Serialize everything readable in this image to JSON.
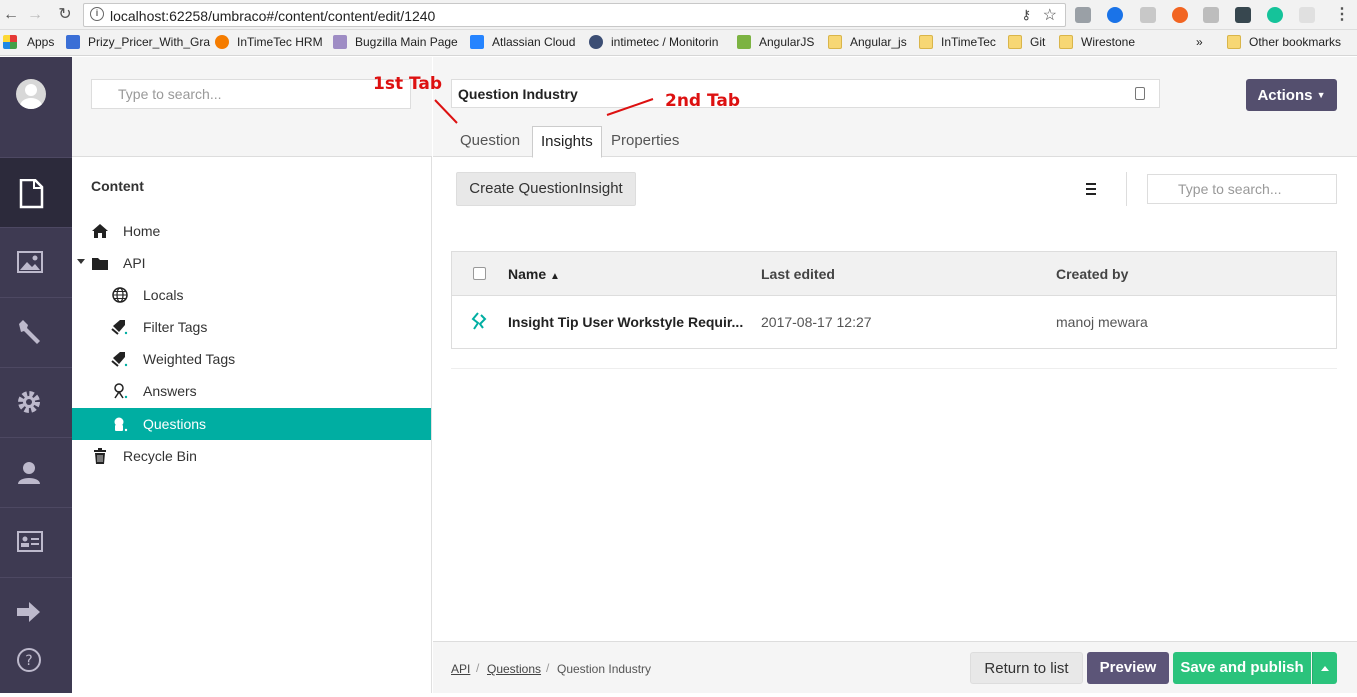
{
  "browser": {
    "url": "localhost:62258/umbraco#/content/content/edit/1240",
    "bookmarks": [
      {
        "label": "Apps",
        "color": "#e53935"
      },
      {
        "label": "Prizy_Pricer_With_Gra",
        "color": "#3b6fd6"
      },
      {
        "label": "InTimeTec HRM",
        "color": "#f57c00"
      },
      {
        "label": "Bugzilla Main Page",
        "color": "#9e8cc4"
      },
      {
        "label": "Atlassian Cloud",
        "color": "#2684ff"
      },
      {
        "label": "intimetec / Monitorin",
        "color": "#3c4e74"
      },
      {
        "label": "AngularJS",
        "color": "#7cb342"
      },
      {
        "label": "Angular_js",
        "color": "folder"
      },
      {
        "label": "InTimeTec",
        "color": "folder"
      },
      {
        "label": "Git",
        "color": "folder"
      },
      {
        "label": "Wirestone",
        "color": "folder"
      },
      {
        "label": "»",
        "color": "none"
      },
      {
        "label": "Other bookmarks",
        "color": "folder"
      }
    ]
  },
  "rail": {
    "items": [
      "content-icon",
      "media-icon",
      "developer-icon",
      "settings-icon",
      "users-icon",
      "members-icon",
      "forms-icon",
      "help-icon"
    ]
  },
  "tree": {
    "search_placeholder": "Type to search...",
    "title": "Content",
    "items": [
      {
        "label": "Home",
        "icon": "home-icon"
      },
      {
        "label": "API",
        "icon": "folder-icon"
      },
      {
        "label": "Locals",
        "icon": "globe-icon"
      },
      {
        "label": "Filter Tags",
        "icon": "tags-icon"
      },
      {
        "label": "Weighted Tags",
        "icon": "tags-icon"
      },
      {
        "label": "Answers",
        "icon": "answer-icon"
      },
      {
        "label": "Questions",
        "icon": "question-icon"
      },
      {
        "label": "Recycle Bin",
        "icon": "trash-icon"
      }
    ]
  },
  "editor": {
    "name": "Question Industry",
    "actions_label": "Actions",
    "tabs": [
      "Question",
      "Insights",
      "Properties"
    ],
    "active_tab": "Insights",
    "annotations": {
      "first": "1st Tab",
      "second": "2nd Tab"
    },
    "annotation_color": "#dd1111",
    "create_label": "Create QuestionInsight",
    "list_search_placeholder": "Type to search...",
    "table": {
      "headers": [
        "Name",
        "Last edited",
        "Created by"
      ],
      "rows": [
        {
          "name": "Insight Tip User Workstyle Requir...",
          "last_edited": "2017-08-17 12:27",
          "created_by": "manoj mewara"
        }
      ]
    },
    "breadcrumb": [
      "API",
      "Questions",
      "Question Industry"
    ],
    "buttons": {
      "return": "Return to list",
      "preview": "Preview",
      "save": "Save and publish"
    }
  },
  "colors": {
    "rail": "#3e3a52",
    "selected": "#00aea2",
    "actions": "#544f6e",
    "save": "#2bc37c"
  }
}
